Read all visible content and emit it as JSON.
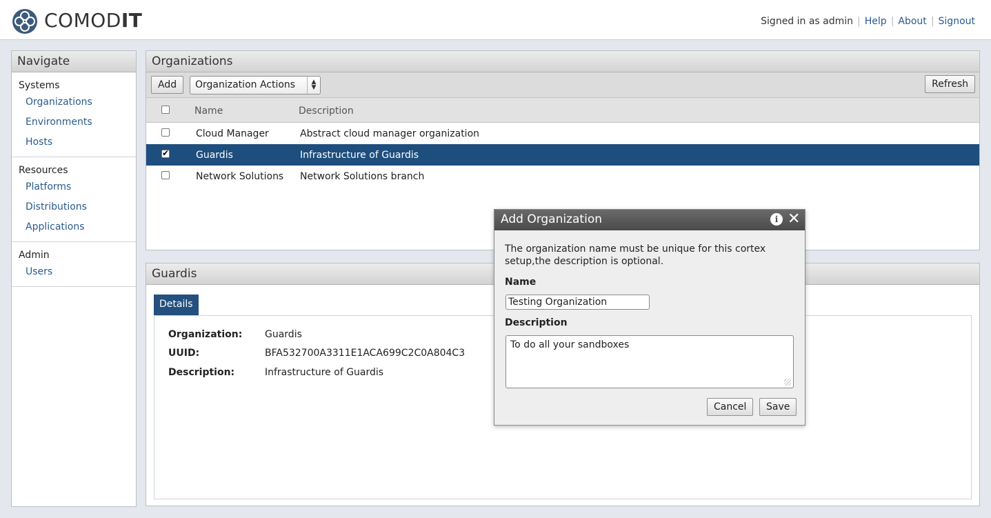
{
  "header": {
    "logo_text_light": "COMOD",
    "logo_text_bold": "IT",
    "signed_in": "Signed in as admin",
    "links": [
      "Help",
      "About",
      "Signout"
    ]
  },
  "nav": {
    "title": "Navigate",
    "sections": [
      {
        "heading": "Systems",
        "items": [
          "Organizations",
          "Environments",
          "Hosts"
        ]
      },
      {
        "heading": "Resources",
        "items": [
          "Platforms",
          "Distributions",
          "Applications"
        ]
      },
      {
        "heading": "Admin",
        "items": [
          "Users"
        ]
      }
    ]
  },
  "organizations": {
    "title": "Organizations",
    "add_label": "Add",
    "actions_label": "Organization Actions",
    "refresh_label": "Refresh",
    "columns": [
      "Name",
      "Description"
    ],
    "rows": [
      {
        "name": "Cloud Manager",
        "description": "Abstract cloud manager organization",
        "checked": false,
        "selected": false
      },
      {
        "name": "Guardis",
        "description": "Infrastructure of Guardis",
        "checked": true,
        "selected": true
      },
      {
        "name": "Network Solutions",
        "description": "Network Solutions branch",
        "checked": false,
        "selected": false
      }
    ]
  },
  "details": {
    "title": "Guardis",
    "tab_label": "Details",
    "fields": [
      {
        "key": "Organization:",
        "value": "Guardis"
      },
      {
        "key": "UUID:",
        "value": "BFA532700A3311E1ACA699C2C0A804C3"
      },
      {
        "key": "Description:",
        "value": "Infrastructure of Guardis"
      }
    ]
  },
  "dialog": {
    "title": "Add Organization",
    "message": "The organization name must be unique for this cortex setup,the description is optional.",
    "name_label": "Name",
    "name_value": "Testing Organization",
    "description_label": "Description",
    "description_value": "To do all your sandboxes",
    "cancel_label": "Cancel",
    "save_label": "Save"
  },
  "colors": {
    "selected_row": "#1e4e7d",
    "link": "#2a5a8c",
    "tab": "#23507e"
  }
}
